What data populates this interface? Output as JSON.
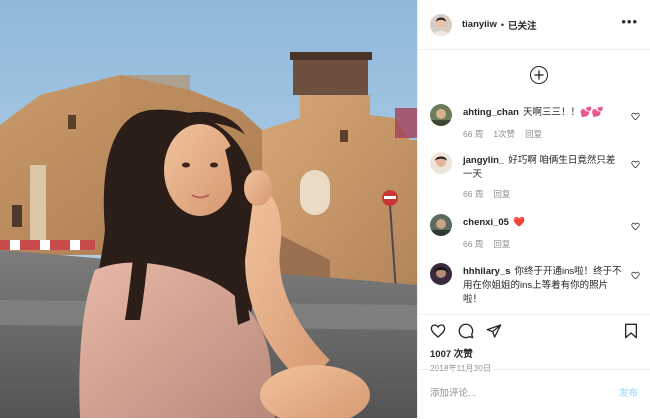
{
  "header": {
    "username": "tianyiiw",
    "dot": "•",
    "follow_status": "已关注",
    "more": "•••"
  },
  "comments": [
    {
      "username": "ahting_chan",
      "text": "天啊三三！！💕💕",
      "time": "66 周",
      "likes": "1次赞",
      "reply": "回复",
      "avatar_color": "#6b7d5a"
    },
    {
      "username": "jangylin_",
      "text": "好巧啊 咱俩生日竟然只差一天",
      "time": "66 周",
      "likes": "",
      "reply": "回复",
      "avatar_color": "#c9a99a"
    },
    {
      "username": "chenxi_05",
      "text": "❤️",
      "time": "66 周",
      "likes": "",
      "reply": "回复",
      "avatar_color": "#5b6b5e"
    },
    {
      "username": "hhhilary_s",
      "text": "你终于开通ins啦！终于不用在你姐姐的ins上等着有你的照片啦！",
      "time": "",
      "likes": "",
      "reply": "",
      "avatar_color": "#3a2a3e"
    }
  ],
  "actions": {
    "likes": "1007 次赞",
    "date": "2018年11月30日"
  },
  "add_comment": {
    "placeholder": "添加评论...",
    "post_label": "发布"
  },
  "colors": {
    "border": "#efefef",
    "text": "#262626",
    "secondary": "#8e8e8e",
    "post_button_disabled": "#b2dffc",
    "heart_red": "#ed4956"
  }
}
